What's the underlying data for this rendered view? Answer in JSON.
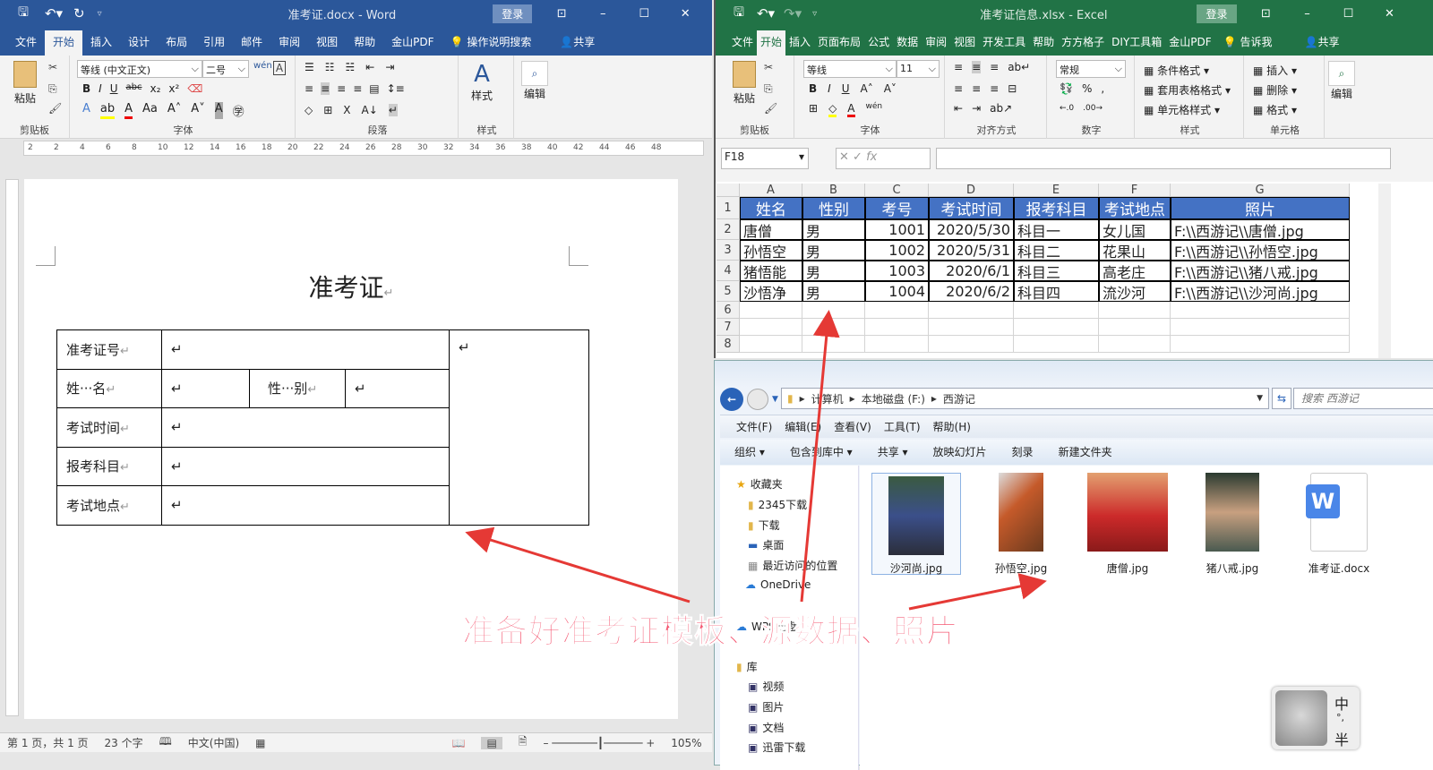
{
  "word": {
    "title": "准考证.docx  -  Word",
    "login": "登录",
    "tabs": [
      "文件",
      "开始",
      "插入",
      "设计",
      "布局",
      "引用",
      "邮件",
      "审阅",
      "视图",
      "帮助",
      "金山PDF"
    ],
    "tell_me": "操作说明搜索",
    "share": "共享",
    "font_name": "等线 (中文正文)",
    "font_size": "二号",
    "groups": {
      "clipboard": "剪贴板",
      "font": "字体",
      "paragraph": "段落",
      "styles": "样式"
    },
    "paste": "粘贴",
    "styles_btn": "样式",
    "edit_btn": "编辑",
    "ruler": [
      "2",
      "2",
      "4",
      "6",
      "8",
      "10",
      "12",
      "14",
      "16",
      "18",
      "20",
      "22",
      "24",
      "26",
      "28",
      "30",
      "32",
      "34",
      "36",
      "38",
      "40",
      "42",
      "44",
      "46",
      "48"
    ],
    "doc_title": "准考证",
    "table": {
      "ticket_no": "准考证号",
      "name": "姓···名",
      "gender": "性···别",
      "exam_time": "考试时间",
      "subject": "报考科目",
      "location": "考试地点"
    },
    "status": {
      "page": "第 1 页，共 1 页",
      "words": "23 个字",
      "lang": "中文(中国)",
      "zoom": "105%"
    }
  },
  "excel": {
    "title": "准考证信息.xlsx  -  Excel",
    "login": "登录",
    "tabs": [
      "文件",
      "开始",
      "插入",
      "页面布局",
      "公式",
      "数据",
      "审阅",
      "视图",
      "开发工具",
      "帮助",
      "方方格子",
      "DIY工具箱",
      "金山PDF"
    ],
    "tell_me": "告诉我",
    "share": "共享",
    "font_name": "等线",
    "font_size": "11",
    "number_format": "常规",
    "styles": [
      "条件格式",
      "套用表格格式",
      "单元格样式"
    ],
    "cells": [
      "插入",
      "删除",
      "格式"
    ],
    "paste": "粘贴",
    "edit_btn": "编辑",
    "groups": {
      "clipboard": "剪贴板",
      "font": "字体",
      "align": "对齐方式",
      "number": "数字",
      "styles": "样式",
      "cells": "单元格"
    },
    "name_box": "F18",
    "fx": "fx",
    "columns": [
      "A",
      "B",
      "C",
      "D",
      "E",
      "F",
      "G"
    ],
    "rows": [
      "1",
      "2",
      "3",
      "4",
      "5",
      "6",
      "7",
      "8"
    ],
    "headers": [
      "姓名",
      "性别",
      "考号",
      "考试时间",
      "报考科目",
      "考试地点",
      "照片"
    ],
    "data": [
      [
        "唐僧",
        "男",
        "1001",
        "2020/5/30",
        "科目一",
        "女儿国",
        "F:\\\\西游记\\\\唐僧.jpg"
      ],
      [
        "孙悟空",
        "男",
        "1002",
        "2020/5/31",
        "科目二",
        "花果山",
        "F:\\\\西游记\\\\孙悟空.jpg"
      ],
      [
        "猪悟能",
        "男",
        "1003",
        "2020/6/1",
        "科目三",
        "高老庄",
        "F:\\\\西游记\\\\猪八戒.jpg"
      ],
      [
        "沙悟净",
        "男",
        "1004",
        "2020/6/2",
        "科目四",
        "流沙河",
        "F:\\\\西游记\\\\沙河尚.jpg"
      ]
    ]
  },
  "explorer": {
    "breadcrumb": [
      "计算机",
      "本地磁盘 (F:)",
      "西游记"
    ],
    "search_placeholder": "搜索 西游记",
    "menu": [
      "文件(F)",
      "编辑(E)",
      "查看(V)",
      "工具(T)",
      "帮助(H)"
    ],
    "toolbar": [
      "组织 ▾",
      "包含到库中 ▾",
      "共享 ▾",
      "放映幻灯片",
      "刻录",
      "新建文件夹"
    ],
    "nav": {
      "favorites": "收藏夹",
      "items": [
        "2345下载",
        "下载",
        "桌面",
        "最近访问的位置"
      ],
      "onedrive": "OneDrive",
      "wps": "WPS网盘",
      "library": "库",
      "lib_items": [
        "视频",
        "图片",
        "文档",
        "迅雷下载"
      ]
    },
    "files": [
      "沙河尚.jpg",
      "孙悟空.jpg",
      "唐僧.jpg",
      "猪八戒.jpg",
      "准考证.docx"
    ]
  },
  "annotation": "准备好准考证模板、源数据、照片",
  "ime": {
    "lang": "中",
    "punct": "°,",
    "width": "半"
  }
}
